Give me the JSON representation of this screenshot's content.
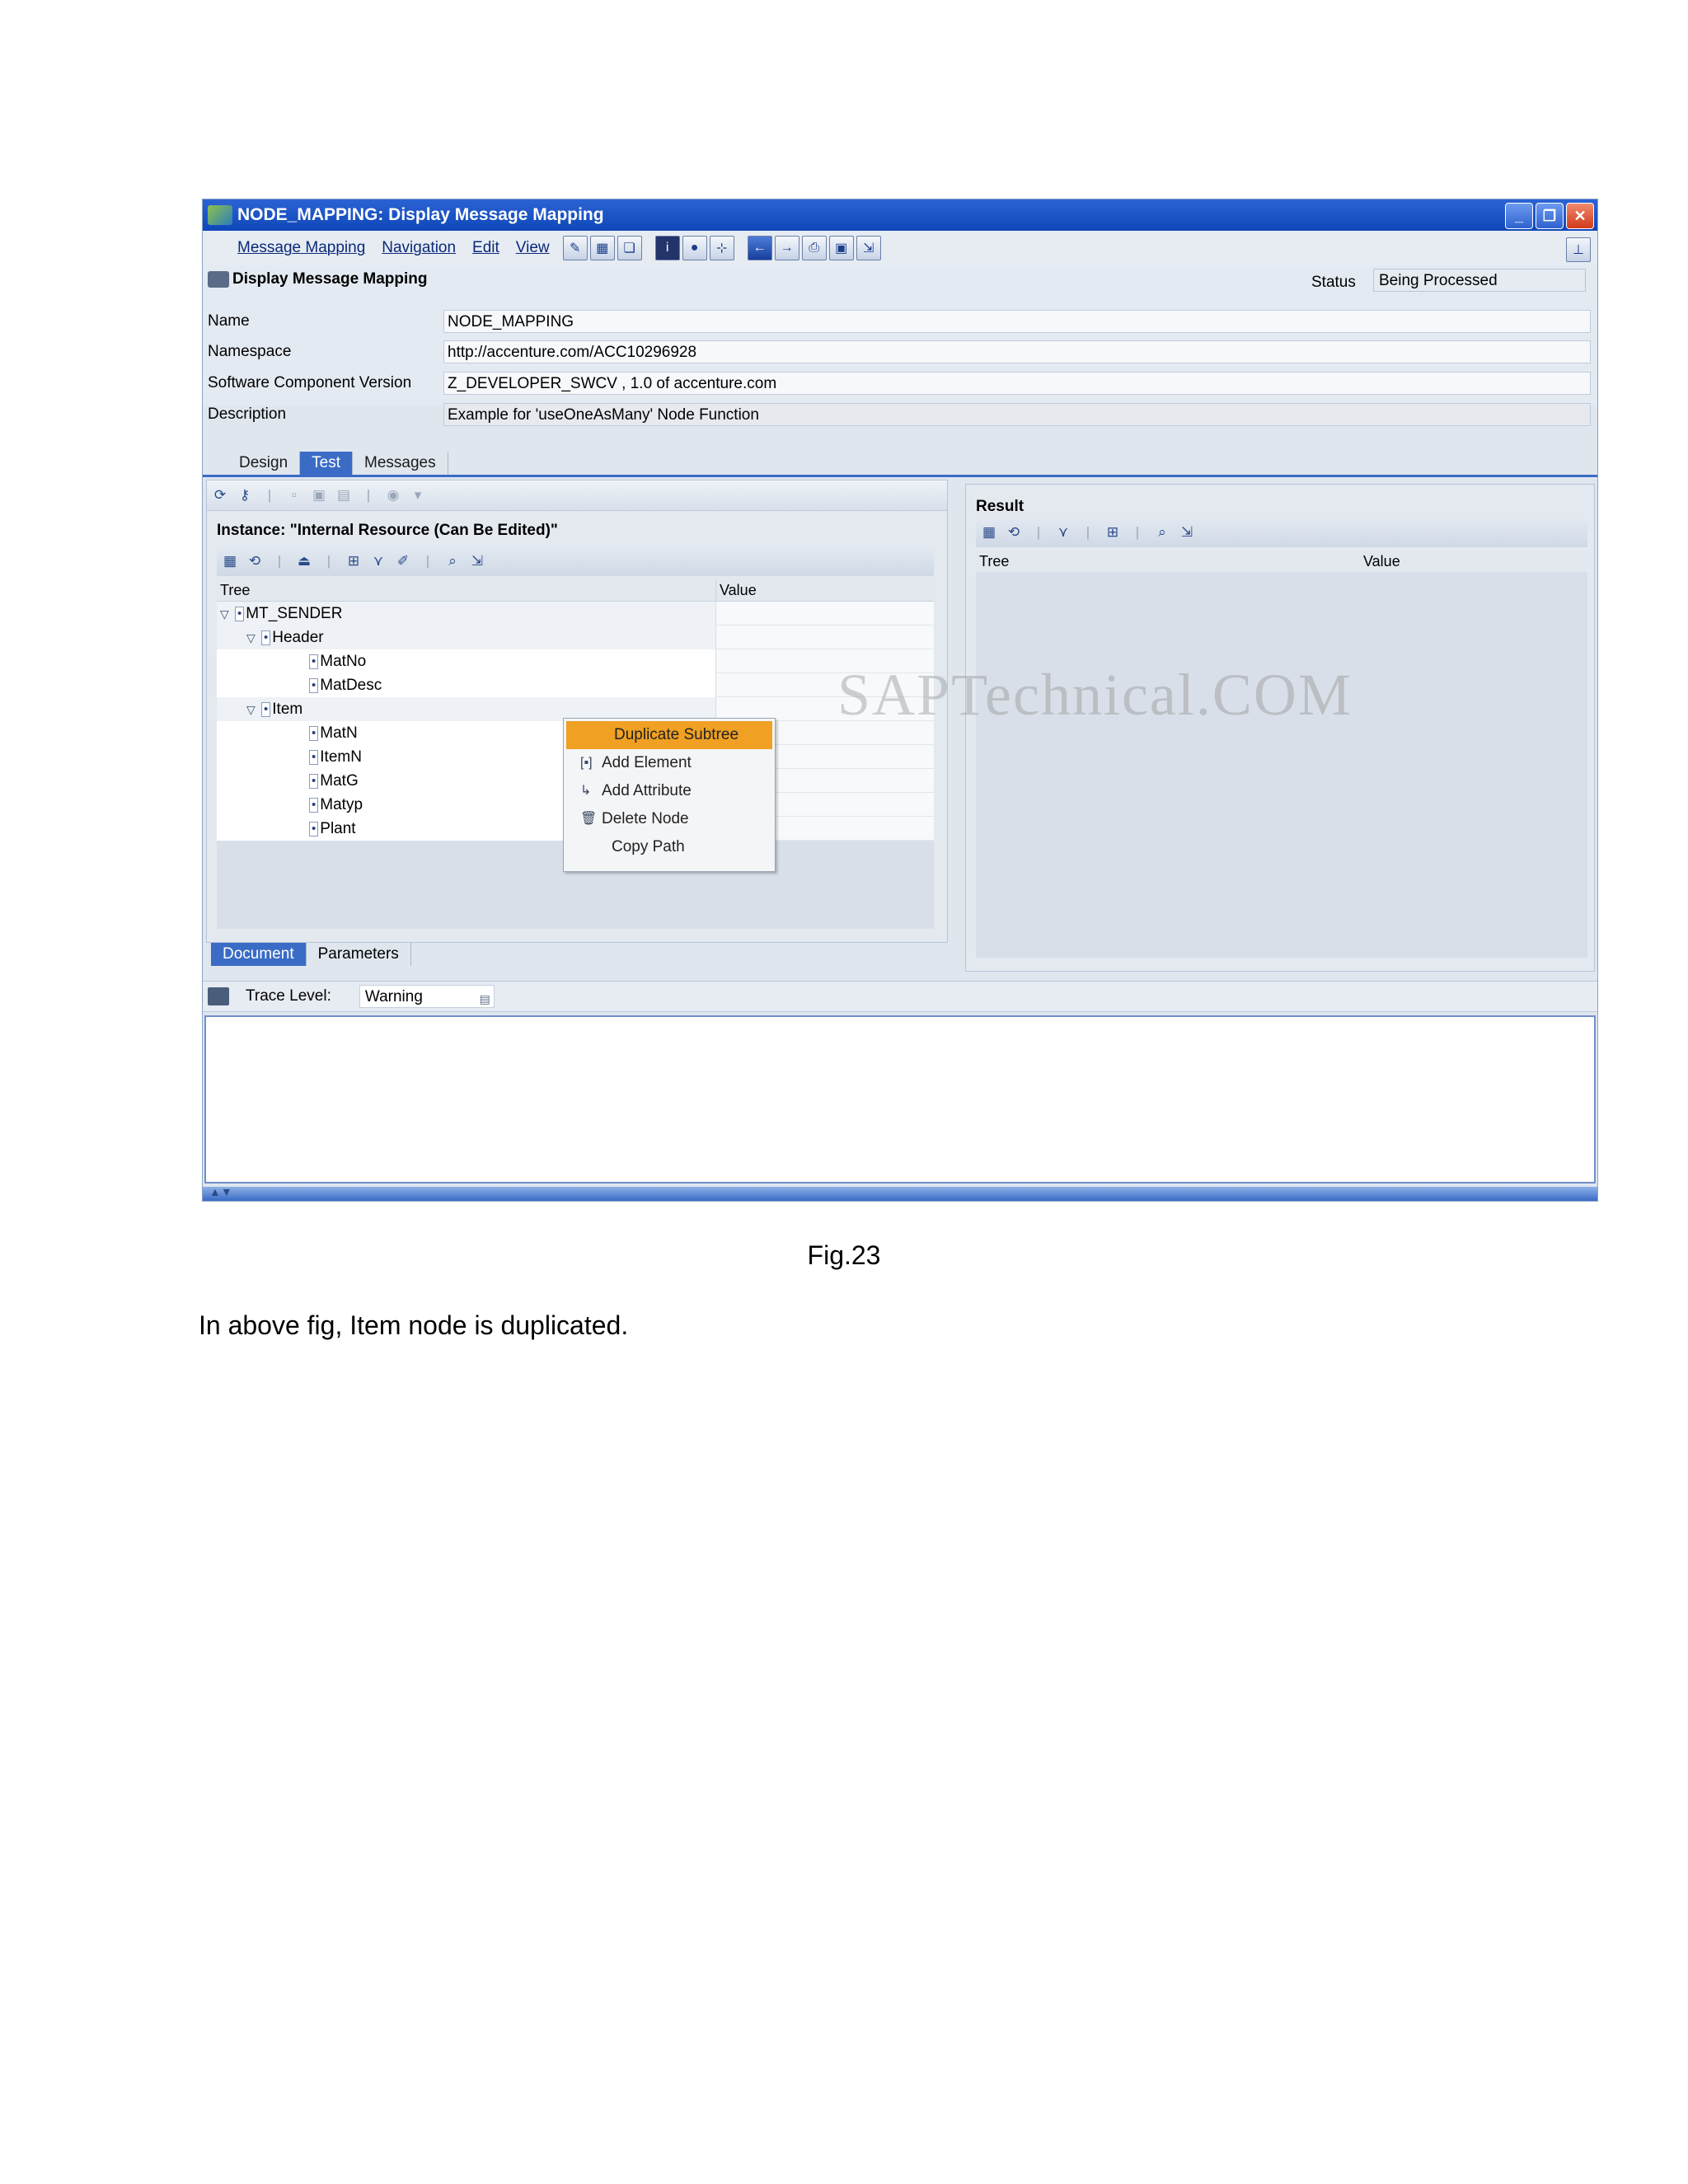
{
  "window": {
    "title": "NODE_MAPPING: Display Message Mapping"
  },
  "menu": {
    "items": [
      "Message Mapping",
      "Navigation",
      "Edit",
      "View"
    ]
  },
  "header": {
    "section_title": "Display Message Mapping",
    "status_label": "Status",
    "status_value": "Being Processed",
    "fields": [
      {
        "label": "Name",
        "value": "NODE_MAPPING"
      },
      {
        "label": "Namespace",
        "value": "http://accenture.com/ACC10296928"
      },
      {
        "label": "Software Component Version",
        "value": "Z_DEVELOPER_SWCV , 1.0 of accenture.com"
      },
      {
        "label": "Description",
        "value": "Example for 'useOneAsMany' Node Function"
      }
    ]
  },
  "tabs": [
    "Design",
    "Test",
    "Messages"
  ],
  "active_tab": "Test",
  "left_pane": {
    "instance_title": "Instance: \"Internal Resource (Can Be Edited)\"",
    "columns": [
      "Tree",
      "Value"
    ],
    "rows": [
      {
        "indent": 0,
        "toggle": "▽",
        "label": "MT_SENDER"
      },
      {
        "indent": 1,
        "toggle": "▽",
        "label": "Header"
      },
      {
        "indent": 2,
        "toggle": "",
        "label": "MatNo"
      },
      {
        "indent": 2,
        "toggle": "",
        "label": "MatDesc"
      },
      {
        "indent": 1,
        "toggle": "▽",
        "label": "Item"
      },
      {
        "indent": 2,
        "toggle": "",
        "label": "MatN"
      },
      {
        "indent": 2,
        "toggle": "",
        "label": "ItemN"
      },
      {
        "indent": 2,
        "toggle": "",
        "label": "MatG"
      },
      {
        "indent": 2,
        "toggle": "",
        "label": "Matyp"
      },
      {
        "indent": 2,
        "toggle": "",
        "label": "Plant"
      }
    ],
    "bottom_tabs": [
      "Document",
      "Parameters"
    ]
  },
  "context_menu": {
    "items": [
      {
        "label": "Duplicate Subtree",
        "icon": "",
        "highlighted": true
      },
      {
        "label": "Add Element",
        "icon": "element-icon",
        "highlighted": false
      },
      {
        "label": "Add Attribute",
        "icon": "attribute-icon",
        "highlighted": false
      },
      {
        "label": "Delete Node",
        "icon": "trash-icon",
        "highlighted": false
      },
      {
        "label": "Copy Path",
        "icon": "",
        "highlighted": false
      }
    ]
  },
  "right_pane": {
    "title": "Result",
    "columns": [
      "Tree",
      "Value"
    ]
  },
  "watermark": "SAPTechnical.COM",
  "trace": {
    "label": "Trace Level:",
    "value": "Warning"
  },
  "figure_caption": "Fig.23",
  "body_text": "In above fig, Item node is duplicated."
}
